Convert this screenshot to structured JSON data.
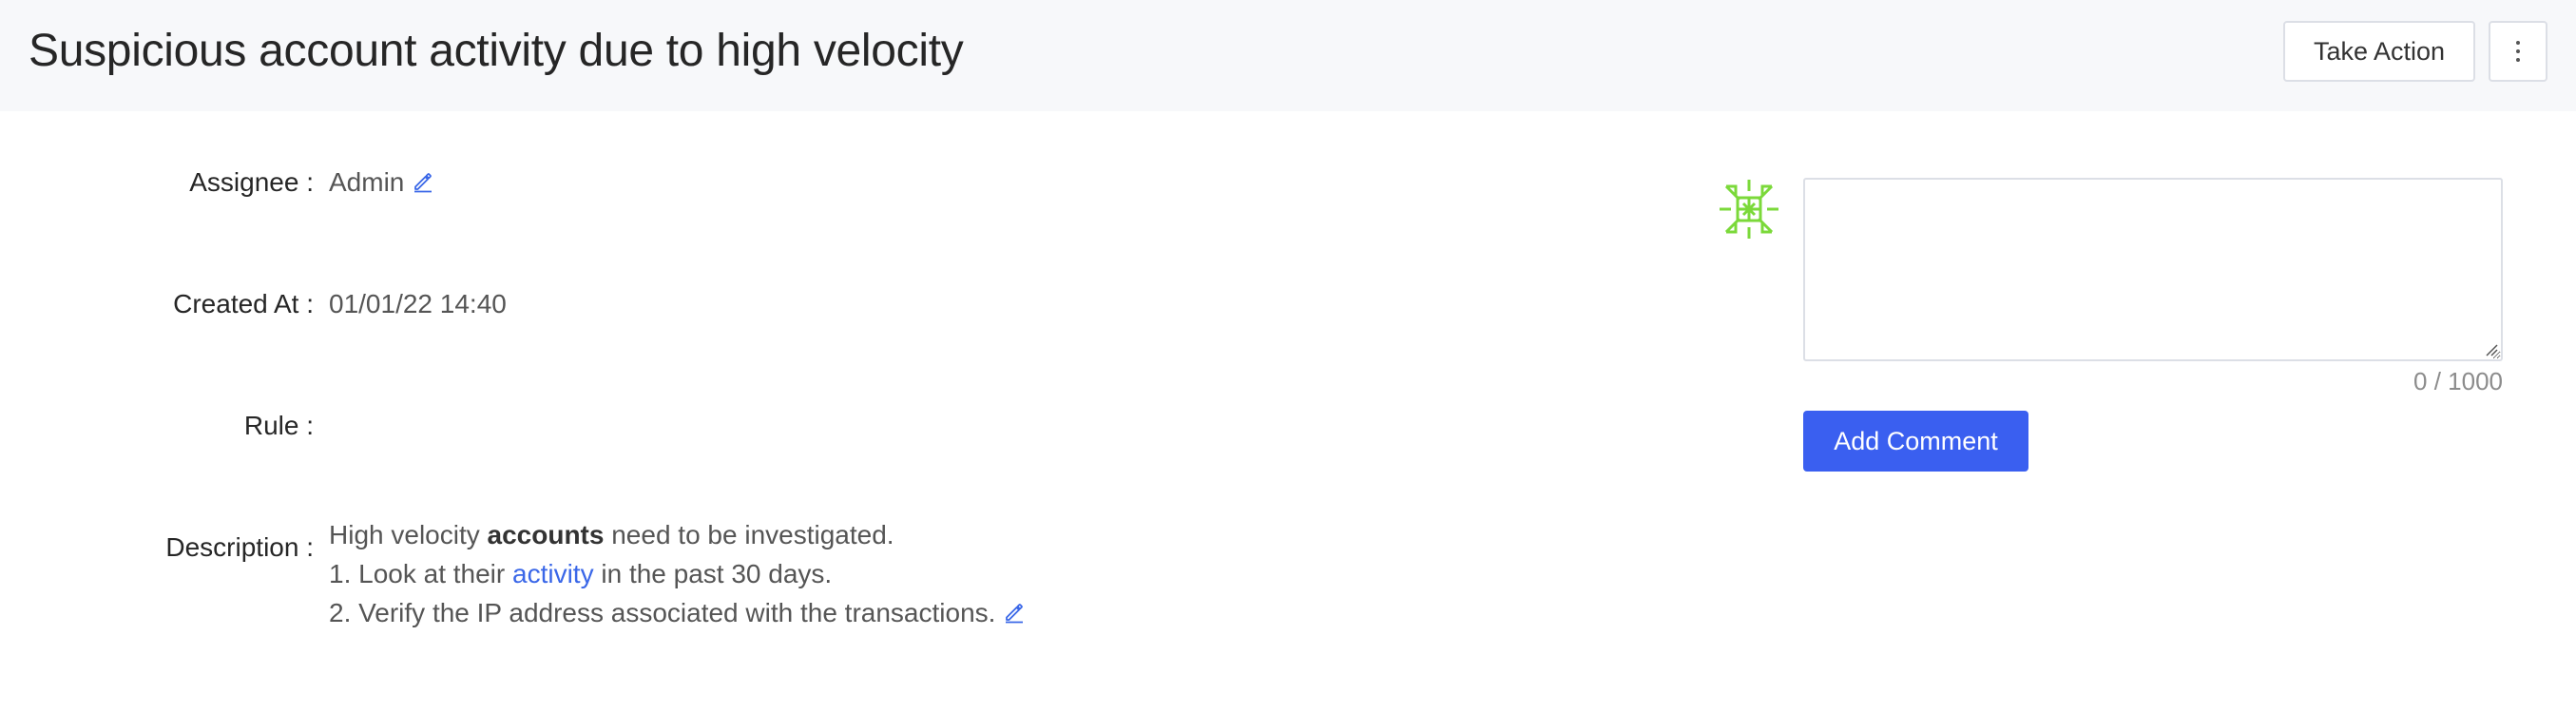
{
  "header": {
    "title": "Suspicious account activity due to high velocity",
    "take_action_label": "Take Action",
    "more_icon": "kebab-vertical-icon"
  },
  "details": {
    "assignee": {
      "label": "Assignee",
      "value": "Admin",
      "edit_icon": "pencil-icon"
    },
    "created_at": {
      "label": "Created At",
      "value": "01/01/22 14:40"
    },
    "rule": {
      "label": "Rule",
      "value": ""
    },
    "description": {
      "label": "Description",
      "line1_prefix": "High velocity ",
      "line1_bold": "accounts",
      "line1_suffix": " need to be investigated.",
      "line2_prefix": "1. Look at their ",
      "line2_link": "activity",
      "line2_suffix": " in the past 30 days.",
      "line3": "2. Verify the IP address associated with the transactions.",
      "edit_icon": "pencil-icon"
    }
  },
  "comments": {
    "avatar_icon": "green-geometric-logo-icon",
    "input_value": "",
    "counter": "0 / 1000",
    "add_button_label": "Add Comment"
  },
  "colors": {
    "header_bg": "#f7f8fa",
    "primary": "#3a5ff0",
    "link": "#3a67e8",
    "logo_green": "#7bd93a"
  }
}
